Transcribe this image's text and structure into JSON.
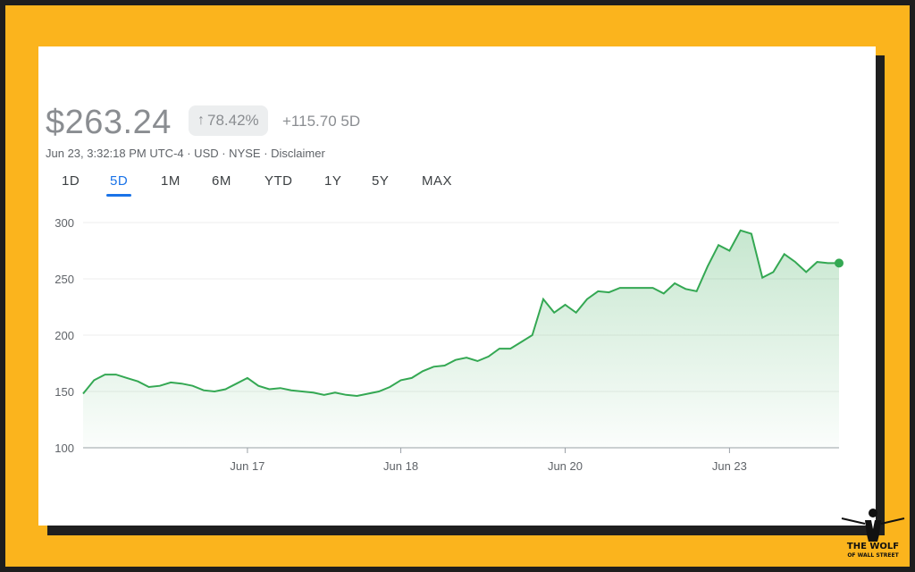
{
  "quote": {
    "price": "$263.24",
    "percent_change": "78.42%",
    "absolute_change": "+115.70",
    "period_label": "5D",
    "meta": "Jun 23, 3:32:18 PM UTC-4 · USD · NYSE · Disclaimer"
  },
  "range_tabs": [
    "1D",
    "5D",
    "1M",
    "6M",
    "YTD",
    "1Y",
    "5Y",
    "MAX"
  ],
  "active_range": "5D",
  "colors": {
    "frame": "#fbb41d",
    "line": "#34a853",
    "muted_text": "#8a8d91",
    "active_tab": "#1a73e8"
  },
  "icons": {
    "change_direction": "arrow-up-icon"
  },
  "logo": {
    "line1": "THE WOLF",
    "line2": "OF WALL STREET"
  },
  "chart_data": {
    "type": "area",
    "title": "",
    "xlabel": "",
    "ylabel": "",
    "ylim": [
      100,
      300
    ],
    "yticks": [
      300,
      250,
      200,
      150,
      100
    ],
    "grid": true,
    "x_tick_labels": [
      {
        "label": "Jun 17",
        "index": 15
      },
      {
        "label": "Jun 18",
        "index": 29
      },
      {
        "label": "Jun 20",
        "index": 44
      },
      {
        "label": "Jun 23",
        "index": 59
      }
    ],
    "series": [
      {
        "values": [
          148,
          160,
          165,
          165,
          162,
          159,
          154,
          155,
          158,
          157,
          155,
          151,
          150,
          152,
          157,
          162,
          155,
          152,
          153,
          151,
          150,
          149,
          147,
          149,
          147,
          146,
          148,
          150,
          154,
          160,
          162,
          168,
          172,
          173,
          178,
          180,
          177,
          181,
          188,
          188,
          194,
          200,
          232,
          220,
          227,
          220,
          232,
          239,
          238,
          242,
          242,
          242,
          242,
          237,
          246,
          241,
          239,
          261,
          280,
          275,
          293,
          290,
          251,
          256,
          272,
          265,
          256,
          265,
          264,
          264
        ],
        "last_value": 263.24
      }
    ]
  }
}
